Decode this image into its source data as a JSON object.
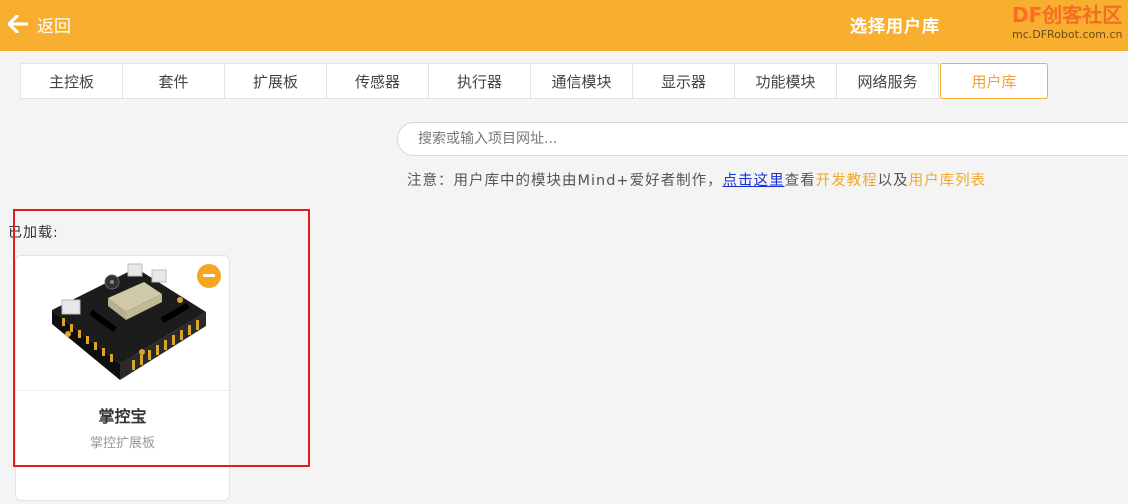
{
  "header": {
    "back_label": "返回",
    "title": "选择用户库",
    "brand": {
      "df": "DF",
      "cn": "创客社区",
      "url": "mc.DFRobot.com.cn"
    },
    "color": "#f8ae2e"
  },
  "tabs": [
    {
      "label": "主控板",
      "active": false
    },
    {
      "label": "套件",
      "active": false
    },
    {
      "label": "扩展板",
      "active": false
    },
    {
      "label": "传感器",
      "active": false
    },
    {
      "label": "执行器",
      "active": false
    },
    {
      "label": "通信模块",
      "active": false
    },
    {
      "label": "显示器",
      "active": false
    },
    {
      "label": "功能模块",
      "active": false
    },
    {
      "label": "网络服务",
      "active": false
    },
    {
      "label": "用户库",
      "active": true
    }
  ],
  "search": {
    "placeholder": "搜索或输入项目网址...",
    "value": ""
  },
  "notice": {
    "prefix": "注意：用户库中的模块由Mind+爱好者制作，",
    "link_here": "点击这里",
    "mid": "查看",
    "link_tutorial": "开发教程",
    "and": "以及",
    "link_list": "用户库列表"
  },
  "loaded": {
    "label": "已加载:",
    "items": [
      {
        "name": "掌控宝",
        "desc": "掌控扩展板",
        "icon": "expansion-board-image"
      }
    ]
  },
  "colors": {
    "accent": "#f8ae2e",
    "link": "#1530d6",
    "highlight": "#e02020"
  }
}
